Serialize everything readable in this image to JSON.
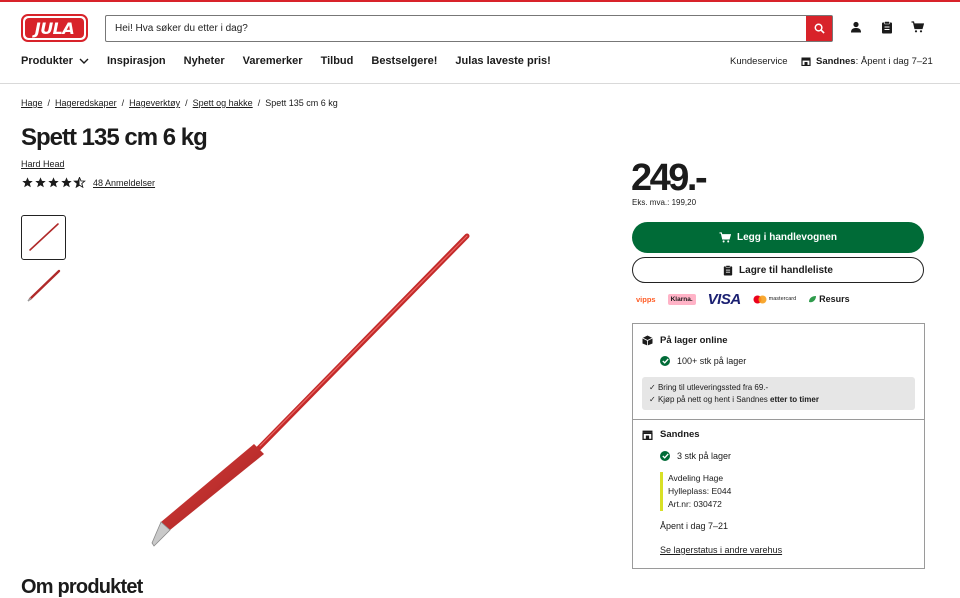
{
  "header": {
    "logo_text": "JULA",
    "search_placeholder": "Hei! Hva søker du etter i dag?"
  },
  "nav": {
    "items": [
      "Produkter",
      "Inspirasjon",
      "Nyheter",
      "Varemerker",
      "Tilbud",
      "Bestselgere!",
      "Julas laveste pris!"
    ],
    "customer_service": "Kundeservice",
    "store_name": "Sandnes",
    "store_hours": "Åpent i dag 7–21"
  },
  "breadcrumb": [
    "Hage",
    "Hageredskaper",
    "Hageverktøy",
    "Spett og hakke",
    "Spett 135 cm 6 kg"
  ],
  "product": {
    "title": "Spett 135 cm 6 kg",
    "brand": "Hard Head",
    "rating": 4.5,
    "reviews_label": "48 Anmeldelser",
    "price": "249.-",
    "ex_vat": "Eks. mva.: 199,20",
    "add_to_cart": "Legg i handlevognen",
    "save_to_list": "Lagre til handleliste",
    "about_heading": "Om produktet"
  },
  "payments": [
    "vipps",
    "Klarna.",
    "VISA",
    "mastercard",
    "Resurs"
  ],
  "stock": {
    "online_heading": "På lager online",
    "online_qty": "100+ stk på lager",
    "delivery_note": "Bring til utleveringssted fra 69.-",
    "pickup_note_prefix": "Kjøp på nett og hent i Sandnes",
    "pickup_note_bold": "etter to timer",
    "store_heading": "Sandnes",
    "store_qty": "3 stk på lager",
    "department": "Avdeling Hage",
    "shelf": "Hylleplass: E044",
    "art_nr": "Art.nr: 030472",
    "store_hours": "Åpent i dag 7–21",
    "other_stores_link": "Se lagerstatus i andre varehus"
  },
  "colors": {
    "brand_red": "#d8232a",
    "cart_green": "#006b37",
    "stock_green": "#006b37"
  }
}
